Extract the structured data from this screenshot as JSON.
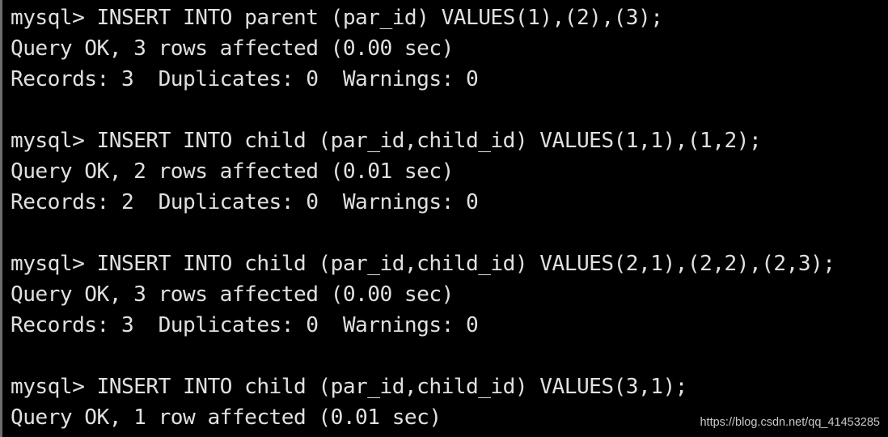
{
  "terminal": {
    "lines": [
      "mysql> INSERT INTO parent (par_id) VALUES(1),(2),(3);",
      "Query OK, 3 rows affected (0.00 sec)",
      "Records: 3  Duplicates: 0  Warnings: 0",
      "",
      "mysql> INSERT INTO child (par_id,child_id) VALUES(1,1),(1,2);",
      "Query OK, 2 rows affected (0.01 sec)",
      "Records: 2  Duplicates: 0  Warnings: 0",
      "",
      "mysql> INSERT INTO child (par_id,child_id) VALUES(2,1),(2,2),(2,3);",
      "Query OK, 3 rows affected (0.00 sec)",
      "Records: 3  Duplicates: 0  Warnings: 0",
      "",
      "mysql> INSERT INTO child (par_id,child_id) VALUES(3,1);",
      "Query OK, 1 row affected (0.01 sec)"
    ]
  },
  "watermark": "https://blog.csdn.net/qq_41453285",
  "colors": {
    "background": "#000000",
    "text": "#e0e0e0",
    "border": "#6e6e6e"
  }
}
